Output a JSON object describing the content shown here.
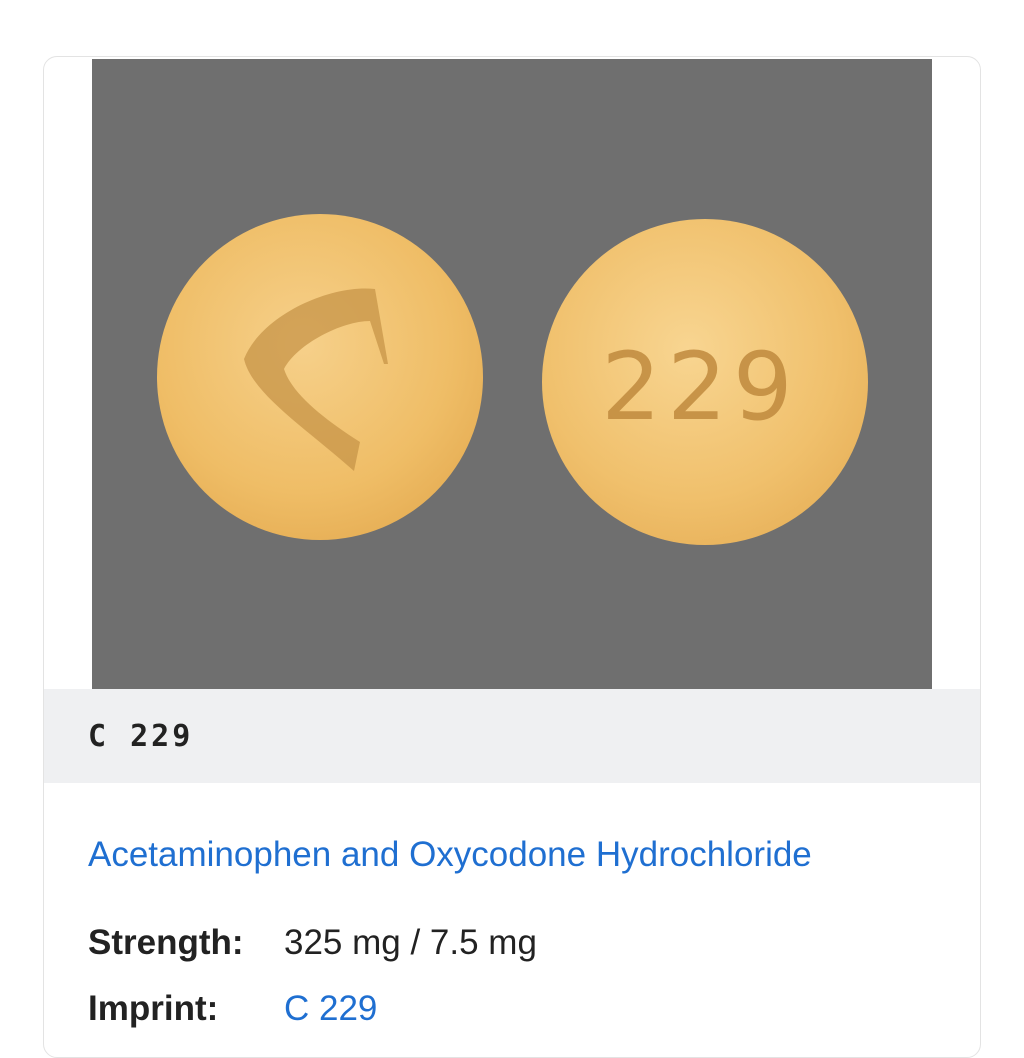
{
  "photo": {
    "background_color": "#6f6f6f",
    "pill_color": "#f0bf6a",
    "left_pill_icon": "c-logo-imprint-icon",
    "right_pill_imprint": "229"
  },
  "imprint_bar": {
    "code": "C 229"
  },
  "drug": {
    "name": "Acetaminophen and Oxycodone Hydrochloride",
    "strength_label": "Strength:",
    "strength_value": "325 mg / 7.5 mg",
    "imprint_label": "Imprint:",
    "imprint_value": "C 229"
  },
  "colors": {
    "link": "#1f6fd1",
    "text": "#222222",
    "bar_bg": "#eff0f2"
  }
}
